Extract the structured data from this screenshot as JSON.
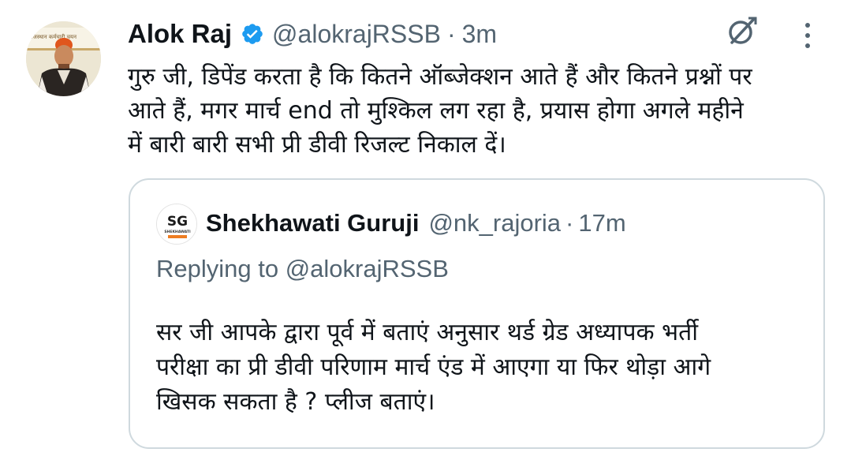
{
  "tweet": {
    "author_name": "Alok Raj",
    "handle": "@alokrajRSSB",
    "separator": "·",
    "time": "3m",
    "text": "गुरु जी, डिपेंड करता है कि कितने ऑब्जेक्शन आते हैं और कितने प्रश्नों पर\nआते हैं, मगर मार्च end तो मुश्किल लग रहा है, प्रयास होगा अगले महीने\nमें बारी बारी  सभी प्री डीवी रिजल्ट निकाल दें।",
    "avatar_banner_text": "राजस्थान कर्मचारी चयन",
    "verified_icon": "verified-badge-icon",
    "grok_icon": "grok-icon",
    "more_icon": "more-vertical-icon"
  },
  "quoted_tweet": {
    "author_name": "Shekhawati Guruji",
    "handle": "@nk_rajoria",
    "separator": "·",
    "time": "17m",
    "avatar_letters": "SG",
    "avatar_caption": "SHEKHAWATI",
    "replying_to": "Replying to @alokrajRSSB",
    "text": "सर जी आपके द्वारा पूर्व में बताएं अनुसार थर्ड ग्रेड अध्यापक भर्ती\nपरीक्षा का प्री डीवी परिणाम मार्च एंड में आएगा या फिर थोड़ा आगे\nखिसक सकता है ? प्लीज बताएं।"
  },
  "colors": {
    "text_primary": "#0f1419",
    "text_secondary": "#536471",
    "verified_blue": "#1d9bf0",
    "card_border": "#cfd9de"
  }
}
